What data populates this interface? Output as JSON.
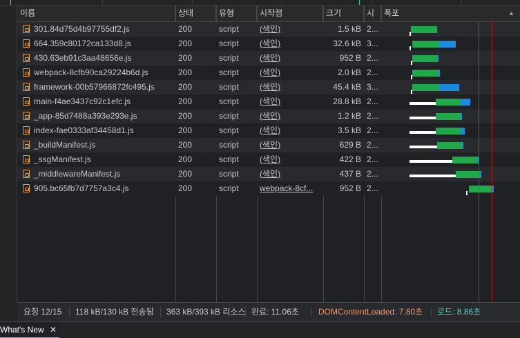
{
  "columns": {
    "name": "이름",
    "status": "상태",
    "type": "유형",
    "initiator": "시작점",
    "size": "크기",
    "time": "시",
    "waterfall": "폭포"
  },
  "rows": [
    {
      "name": "301.84d75d4b97755df2.js",
      "status": "200",
      "type": "script",
      "initiator": "(색인)",
      "size": "1.5 kB",
      "time": "2..."
    },
    {
      "name": "664.359c80172ca133d8.js",
      "status": "200",
      "type": "script",
      "initiator": "(색인)",
      "size": "32.6 kB",
      "time": "3..."
    },
    {
      "name": "430.63eb91c3aa48656e.js",
      "status": "200",
      "type": "script",
      "initiator": "(색인)",
      "size": "952 B",
      "time": "2..."
    },
    {
      "name": "webpack-8cfb90ca29224b6d.js",
      "status": "200",
      "type": "script",
      "initiator": "(색인)",
      "size": "2.0 kB",
      "time": "2..."
    },
    {
      "name": "framework-00b57966872fc495.js",
      "status": "200",
      "type": "script",
      "initiator": "(색인)",
      "size": "45.4 kB",
      "time": "3..."
    },
    {
      "name": "main-f4ae3437c92c1efc.js",
      "status": "200",
      "type": "script",
      "initiator": "(색인)",
      "size": "28.8 kB",
      "time": "2..."
    },
    {
      "name": "_app-85d7488a393e293e.js",
      "status": "200",
      "type": "script",
      "initiator": "(색인)",
      "size": "1.2 kB",
      "time": "2..."
    },
    {
      "name": "index-fae0333af34458d1.js",
      "status": "200",
      "type": "script",
      "initiator": "(색인)",
      "size": "3.5 kB",
      "time": "2..."
    },
    {
      "name": "_buildManifest.js",
      "status": "200",
      "type": "script",
      "initiator": "(색인)",
      "size": "629 B",
      "time": "2..."
    },
    {
      "name": "_ssgManifest.js",
      "status": "200",
      "type": "script",
      "initiator": "(색인)",
      "size": "422 B",
      "time": "2..."
    },
    {
      "name": "_middlewareManifest.js",
      "status": "200",
      "type": "script",
      "initiator": "(색인)",
      "size": "437 B",
      "time": "2..."
    },
    {
      "name": "905.bc65fb7d7757a3c4.js",
      "status": "200",
      "type": "script",
      "initiator": "webpack-8cf...",
      "size": "952 B",
      "time": "2..."
    }
  ],
  "status_bar": {
    "requests": "요청 12/15",
    "transferred": "118 kB/130 kB 전송됨",
    "resources": "363 kB/393 kB 리소스",
    "finish": "완료: 11.06초",
    "dom_content_loaded": "DOMContentLoaded: 7.80초",
    "load": "로드: 8.86초"
  },
  "drawer": {
    "tab_label": "What's New",
    "close_icon": "close-icon"
  },
  "colors": {
    "dcl_line": "#1a73e8",
    "load_line": "#c5221f",
    "receiving": "#1fa94b",
    "downloading": "#1a8ae0",
    "waiting": "#ffffff",
    "file_icon": "#e8a33c",
    "dcl_text": "#f29766",
    "load_text": "#4dd4c6"
  },
  "icons": {
    "file": "script-file-icon",
    "sort": "sort-ascending-icon"
  }
}
